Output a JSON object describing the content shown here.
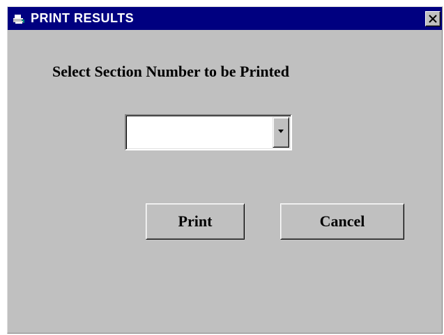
{
  "window": {
    "title": "PRINT RESULTS",
    "icon": "printer-app-icon",
    "close_icon": "close-icon",
    "colors": {
      "titlebar": "#000080",
      "face": "#c0c0c0",
      "title_text": "#ffffff"
    }
  },
  "dialog": {
    "prompt": "Select Section Number to be Printed",
    "section_select": {
      "value": "",
      "dropdown_icon": "chevron-down-icon"
    },
    "buttons": {
      "print_label": "Print",
      "cancel_label": "Cancel"
    }
  }
}
